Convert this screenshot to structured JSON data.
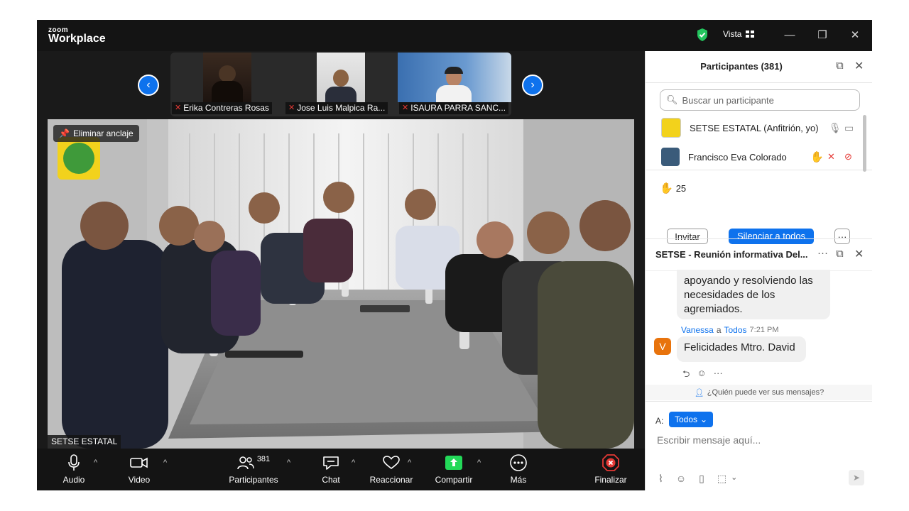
{
  "app": {
    "logo_small": "zoom",
    "logo_big": "Workplace",
    "view_label": "Vista"
  },
  "thumbnails": [
    {
      "name": "Erika Contreras Rosas"
    },
    {
      "name": "Jose Luis Malpica Ra..."
    },
    {
      "name": "ISAURA PARRA SANC..."
    }
  ],
  "main_video": {
    "unpin_label": "Eliminar anclaje",
    "speaker_label": "SETSE ESTATAL"
  },
  "toolbar": {
    "audio": "Audio",
    "video": "Video",
    "participants": "Participantes",
    "participants_count": "381",
    "chat": "Chat",
    "react": "Reaccionar",
    "share": "Compartir",
    "more": "Más",
    "end": "Finalizar"
  },
  "participants_panel": {
    "title": "Participantes (381)",
    "search_placeholder": "Buscar un participante",
    "rows": [
      {
        "name": "SETSE ESTATAL (Anfitrión, yo)"
      },
      {
        "name": "Francisco Eva Colorado"
      }
    ],
    "raised_hands": "25",
    "invite": "Invitar",
    "mute_all": "Silenciar a todos"
  },
  "chat_panel": {
    "title": "SETSE - Reunión informativa Del...",
    "prev_message": "apoyando y resolviendo las necesidades de los agremiados.",
    "sender": "Vanessa",
    "to_word": "a",
    "recipient": "Todos",
    "time": "7:21 PM",
    "avatar_letter": "V",
    "message": "Felicidades Mtro. David",
    "who_can_see": "¿Quién puede ver sus mensajes?",
    "to_label": "A:",
    "to_value": "Todos",
    "input_placeholder": "Escribir mensaje aquí..."
  },
  "colors": {
    "accent": "#0e72ed",
    "danger": "#e53935",
    "share_green": "#23d959",
    "avatar_orange": "#e8730c"
  }
}
